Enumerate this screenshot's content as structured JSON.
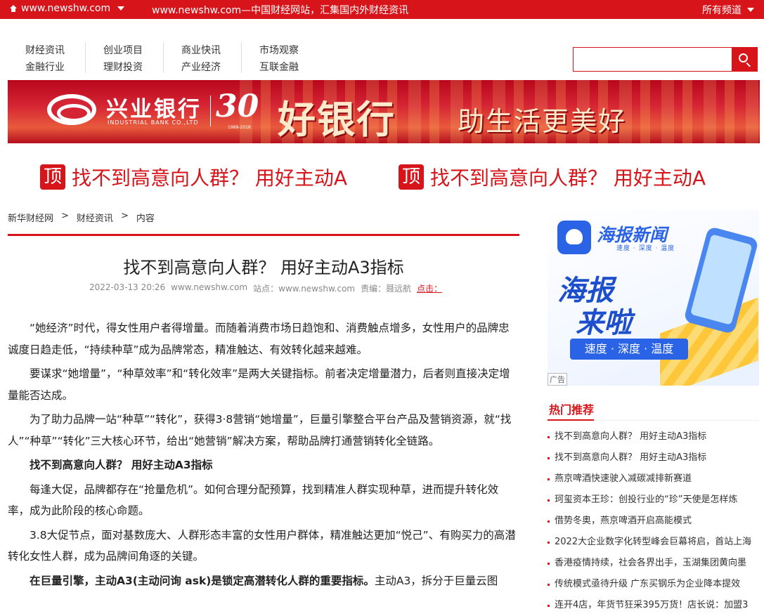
{
  "topbar": {
    "site": "www.newshw.com",
    "slogan": "www.newshw.com—中国财经网站，汇集国内外财经资讯",
    "channels": "所有频道"
  },
  "nav": [
    [
      "财经资讯",
      "金融行业"
    ],
    [
      "创业项目",
      "理财投资"
    ],
    [
      "商业快讯",
      "产业经济"
    ],
    [
      "市场观察",
      "互联金融"
    ]
  ],
  "search": {
    "value": "",
    "placeholder": ""
  },
  "banner": {
    "bank_name": "兴业银行",
    "bank_en": "INDUSTRIAL BANK CO.,LTD",
    "anniv": "30",
    "anniv_sub": "1988-2018",
    "slogan_big": "好银行",
    "slogan_small": "助生活更美好"
  },
  "ticker": [
    {
      "badge": "顶",
      "text": "找不到高意向人群？ 用好主动A"
    },
    {
      "badge": "顶",
      "text": "找不到高意向人群？ 用好主动A"
    }
  ],
  "breadcrumb": [
    "新华财经网",
    ">",
    "财经资讯",
    ">",
    "内容"
  ],
  "article": {
    "title": "找不到高意向人群？ 用好主动A3指标",
    "date": "2022-03-13 20:26",
    "source": "www.newshw.com",
    "site": "站点：www.newshw.com",
    "editor": "责编：聂远航",
    "clicks": "点击："
  },
  "body": [
    {
      "type": "p",
      "text": "“她经济”时代，得女性用户者得增量。而随着消费市场日趋饱和、消费触点增多，女性用户的品牌忠诚度日趋走低，“持续种草”成为品牌常态，精准触达、有效转化越来越难。"
    },
    {
      "type": "p",
      "text": "要谋求“她增量”，“种草效率”和“转化效率”是两大关键指标。前者决定增量潜力，后者则直接决定增量能否达成。"
    },
    {
      "type": "p",
      "text": "为了助力品牌一站“种草”“转化”，获得3·8营销“她增量”，巨量引擎整合平台产品及营销资源，就“找人”“种草”“转化”三大核心环节，给出“她营销”解决方案，帮助品牌打通营销转化全链路。"
    },
    {
      "type": "h",
      "text": "找不到高意向人群？ 用好主动A3指标"
    },
    {
      "type": "p",
      "text": "每逢大促，品牌都存在“抢量危机”。如何合理分配预算，找到精准人群实现种草，进而提升转化效率，成为此阶段的核心命题。"
    },
    {
      "type": "p",
      "text": "3.8大促节点，面对基数庞大、人群形态丰富的女性用户群体，精准触达更加“悦己”、有购买力的高潜转化女性人群，成为品牌间角逐的关键。"
    },
    {
      "type": "mixed",
      "bold": "在巨量引擎，主动A3(主动问询 ask)是锁定高潜转化人群的重要指标。",
      "text": "主动A3，拆分于巨量云图"
    }
  ],
  "ad": {
    "brand": "海报新闻",
    "brand_sub": "速度 · 深度 · 温度",
    "big1": "海报",
    "big2": "来啦",
    "pill": "速度 · 深度 · 温度",
    "tag": "广告"
  },
  "hot": {
    "title": "热门推荐",
    "items": [
      "找不到高意向人群？ 用好主动A3指标",
      "找不到高意向人群？ 用好主动A3指标",
      "燕京啤酒快速驶入减碳减排新赛道",
      "珂玺资本王珍：创投行业的“珍”天使是怎样炼",
      "借势冬奥，燕京啤酒开启高能模式",
      "2022大企业数字化转型峰会巨幕将启，首站上海",
      "香港疫情持续，社会各界出手，玉湖集团黄向墨",
      "传统模式亟待升级 广东买钢乐为企业降本提效",
      "连开4店，年货节狂采395万货！店长说：加盟3"
    ]
  },
  "colors": {
    "brand_red": "#d7141a",
    "ad_blue": "#2b63e6"
  }
}
